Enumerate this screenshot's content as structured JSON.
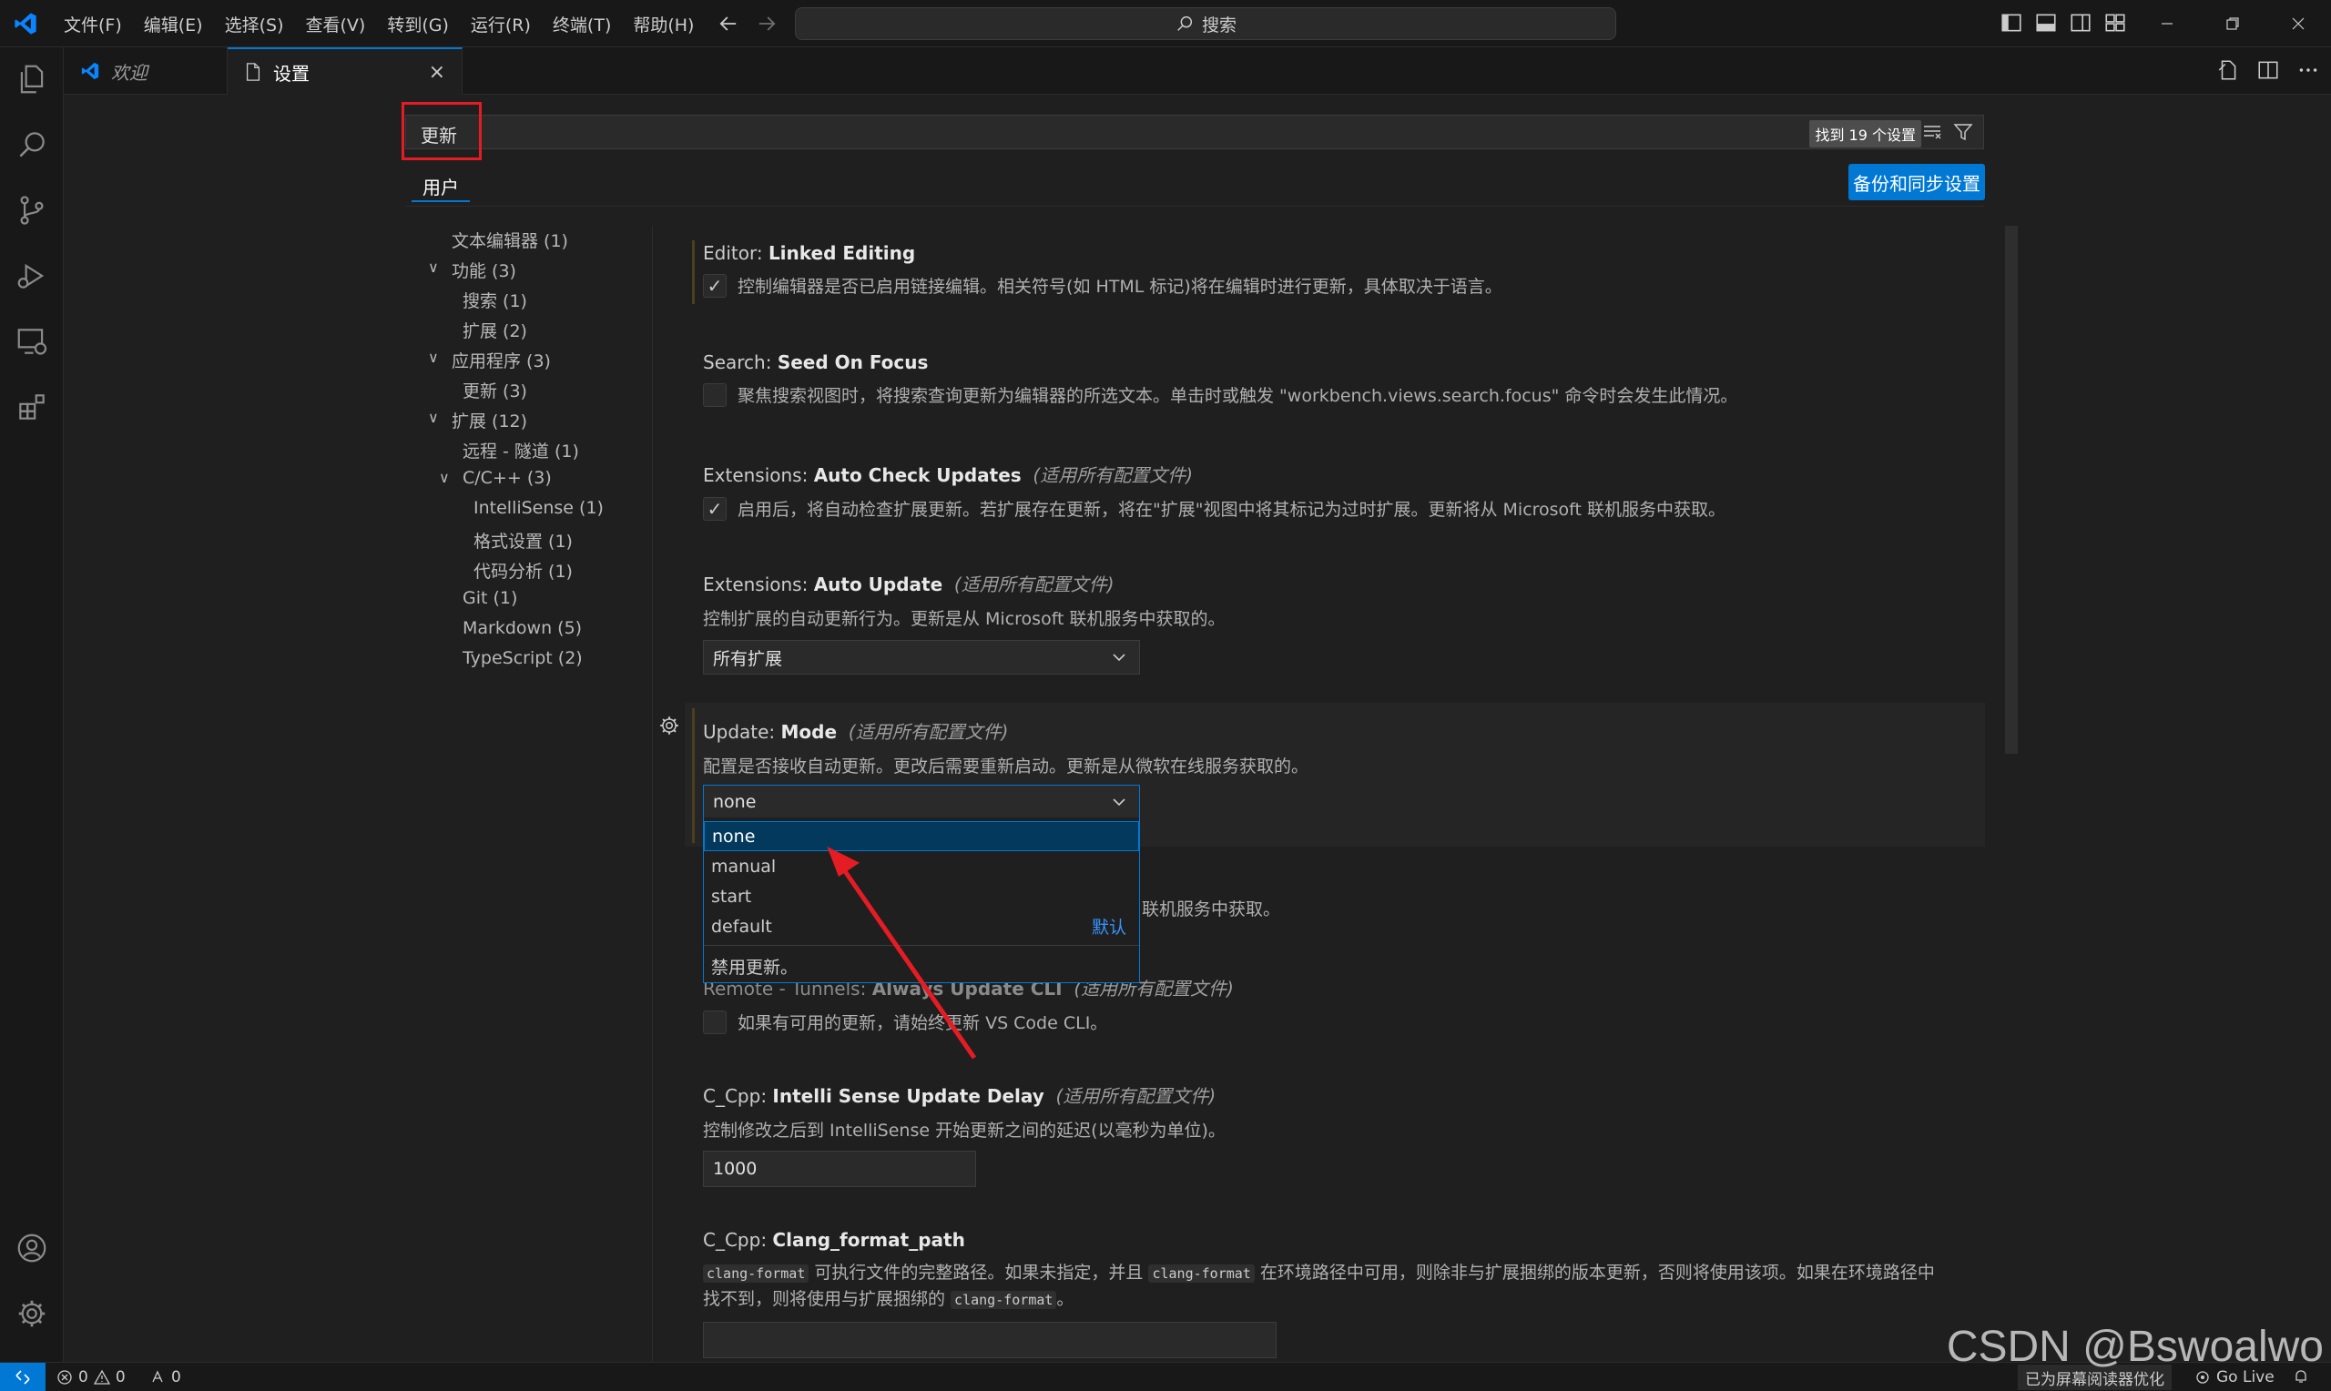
{
  "menu": [
    "文件(F)",
    "编辑(E)",
    "选择(S)",
    "查看(V)",
    "转到(G)",
    "运行(R)",
    "终端(T)",
    "帮助(H)"
  ],
  "command_search": "搜索",
  "tabs": [
    {
      "label": "欢迎",
      "icon": "vscode-logo-icon"
    },
    {
      "label": "设置",
      "icon": "file-icon",
      "close": "×"
    }
  ],
  "settings_search": {
    "value": "更新",
    "found": "找到 19 个设置"
  },
  "scope_tab": "用户",
  "sync_button": "备份和同步设置",
  "toc": [
    {
      "label": "文本编辑器 (1)"
    },
    {
      "label": "功能 (3)",
      "chev": "∨"
    },
    {
      "label": "搜索 (1)"
    },
    {
      "label": "扩展 (2)"
    },
    {
      "label": "应用程序 (3)",
      "chev": "∨"
    },
    {
      "label": "更新 (3)"
    },
    {
      "label": "扩展 (12)",
      "chev": "∨"
    },
    {
      "label": "远程 - 隧道 (1)"
    },
    {
      "label": "C/C++ (3)",
      "chev": "∨"
    },
    {
      "label": "IntelliSense (1)"
    },
    {
      "label": "格式设置 (1)"
    },
    {
      "label": "代码分析 (1)"
    },
    {
      "label": "Git (1)"
    },
    {
      "label": "Markdown (5)"
    },
    {
      "label": "TypeScript (2)"
    }
  ],
  "settings": {
    "linked_editing": {
      "prefix": "Editor: ",
      "name": "Linked Editing",
      "desc": "控制编辑器是否已启用链接编辑。相关符号(如 HTML 标记)将在编辑时进行更新，具体取决于语言。",
      "checked": "✓"
    },
    "seed_on_focus": {
      "prefix": "Search: ",
      "name": "Seed On Focus",
      "desc": "聚焦搜索视图时，将搜索查询更新为编辑器的所选文本。单击时或触发 \"workbench.views.search.focus\" 命令时会发生此情况。"
    },
    "auto_check": {
      "prefix": "Extensions: ",
      "name": "Auto Check Updates",
      "scope": "(适用所有配置文件)",
      "desc": "启用后，将自动检查扩展更新。若扩展存在更新，将在\"扩展\"视图中将其标记为过时扩展。更新将从 Microsoft 联机服务中获取。",
      "checked": "✓"
    },
    "auto_update": {
      "prefix": "Extensions: ",
      "name": "Auto Update",
      "scope": "(适用所有配置文件)",
      "desc": "控制扩展的自动更新行为。更新是从 Microsoft 联机服务中获取的。",
      "value": "所有扩展"
    },
    "update_mode": {
      "prefix": "Update: ",
      "name": "Mode",
      "scope": "(适用所有配置文件)",
      "desc": "配置是否接收自动更新。更改后需要重新启动。更新是从微软在线服务获取的。",
      "value": "none"
    },
    "hidden_desc_tail": "联机服务中获取。",
    "tunnels": {
      "prefix": "Remote - Tunnels: ",
      "name": "Always Update CLI",
      "scope": "(适用所有配置文件)",
      "desc_a": "如果有可用的更新，请始",
      "desc_b": "更新 VS Code CLI。"
    },
    "intellisense_delay": {
      "prefix": "C_Cpp: ",
      "name": "Intelli Sense Update Delay",
      "scope": "(适用所有配置文件)",
      "desc": "控制修改之后到 IntelliSense 开始更新之间的延迟(以毫秒为单位)。",
      "value": "1000"
    },
    "clang_format": {
      "prefix": "C_Cpp: ",
      "name": "Clang_format_path",
      "code": "clang-format",
      "desc1": " 可执行文件的完整路径。如果未指定，并且 ",
      "desc2": " 在环境路径中可用，则除非与扩展捆绑的版本更新，否则将使用该项。如果在环境路径中",
      "desc3": "找不到，则将使用与扩展捆绑的 ",
      "desc4": "。"
    }
  },
  "dropdown": {
    "options": [
      "none",
      "manual",
      "start",
      "default"
    ],
    "default_label": "默认",
    "description": "禁用更新。"
  },
  "statusbar": {
    "errors": "0",
    "warnings": "0",
    "ports": "0",
    "screen_reader": "已为屏幕阅读器优化",
    "go_live": "Go Live"
  },
  "watermark": "CSDN @Bswoalwo",
  "colors": {
    "accent": "#0078d4",
    "annotation_red": "#e51c23"
  }
}
